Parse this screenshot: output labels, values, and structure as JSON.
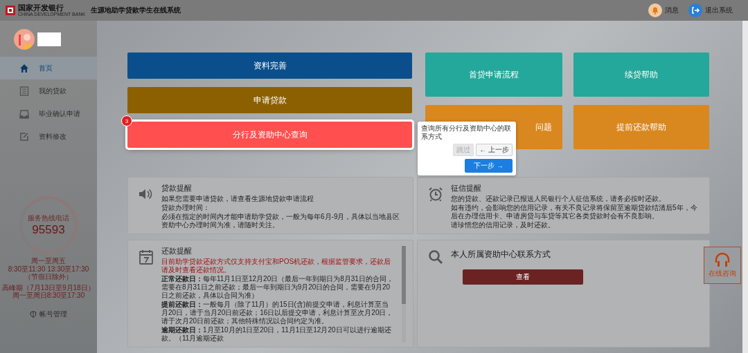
{
  "header": {
    "bank_name": "国家开发银行",
    "bank_name_en": "CHINA DEVELOPMENT BANK",
    "system_title": "生源地助学贷款学生在线系统",
    "actions": [
      {
        "label": "消息",
        "kind": "bell"
      },
      {
        "label": "退出系统",
        "kind": "logout"
      }
    ]
  },
  "sidebar": {
    "items": [
      {
        "label": "首页",
        "kind": "home",
        "selected": true
      },
      {
        "label": "我的贷款",
        "kind": "list",
        "selected": false
      },
      {
        "label": "毕业确认申请",
        "kind": "inbox",
        "selected": false
      },
      {
        "label": "资料修改",
        "kind": "edit",
        "selected": false
      }
    ],
    "hotline": {
      "title": "服务热线电话",
      "number": "95593",
      "hours": [
        "周一至周五",
        "8:30至11:30 13:30至17:30",
        "（节假日除外）"
      ],
      "peak_hours": [
        "高峰期（7月13日至9月18日）",
        "周一至周日8:30至17:30"
      ]
    },
    "account": "帐号管理"
  },
  "action_buttons": [
    {
      "label": "资料完善",
      "color": "#0a4f8c",
      "highlighted": false
    },
    {
      "label": "申请贷款",
      "color": "#8c6000",
      "highlighted": false
    },
    {
      "label": "分行及资助中心查询",
      "color": "#ff4f4f",
      "highlighted": true
    }
  ],
  "help_tiles": [
    {
      "label": "首贷申请流程",
      "color": "#24a89b"
    },
    {
      "label": "续贷帮助",
      "color": "#24a89b"
    },
    {
      "label": "问题",
      "color": "#d9871f"
    },
    {
      "label": "提前还款帮助",
      "color": "#d9871f"
    }
  ],
  "tour": {
    "step": "3",
    "text": "查询所有分行及资助中心的联系方式",
    "buttons": [
      {
        "label": "跳过",
        "disabled": true,
        "primary": false
      },
      {
        "label": "← 上一步",
        "disabled": false,
        "primary": false
      },
      {
        "label": "下一步 →",
        "disabled": false,
        "primary": true
      }
    ]
  },
  "panels": [
    {
      "kind": "speaker",
      "title": "贷款提醒",
      "lines": [
        {
          "text": "如果您需要申请贷款，请查看生源地贷款申请流程",
          "kind": "plain"
        },
        {
          "text": "贷款办理时间：",
          "kind": "plain"
        },
        {
          "text": "必须在指定的时间内才能申请助学贷款，一般为每年6月-9月，具体以当地县区资助中心办理时间为准，请随时关注。",
          "kind": "plain"
        }
      ]
    },
    {
      "kind": "clock",
      "title": "征信提醒",
      "lines": [
        {
          "text": "您的贷款、还款记录已报送人民银行个人征信系统，请务必按时还款。",
          "kind": "plain"
        },
        {
          "text": "如有违约，会影响您的信用记录，有关不良记录将保留至逾期贷款结清后5年，今后在办理信用卡、申请房贷与车贷等其它各类贷款时会有不良影响。",
          "kind": "plain"
        },
        {
          "text": "请珍惜您的信用记录，及时还款。",
          "kind": "plain"
        }
      ]
    },
    {
      "kind": "calendar",
      "title": "还款提醒",
      "lines": [
        {
          "text": "目前助学贷款还款方式仅支持支付宝和POS机还款，根据监管要求，还款后请及时查看还款情况。",
          "kind": "warning"
        },
        {
          "text": "**正常还款日：**每年11月1日至12月20日（最后一年到期日为8月31日的合同，需要在8月31日之前还款；最后一年到期日为9月20日的合同，需要在9月20日之前还款，具体以合同为准）",
          "kind": "plain"
        },
        {
          "text": "**提前还款日：**一般每月（除了11月）的15日(含)前提交申请，利息计算至当月20日，请于当月20日前还款；16日以后提交申请，利息计算至次月20日，请于次月20日前还款；其他特殊情况以合同约定为准。",
          "kind": "plain"
        },
        {
          "text": "**逾期还款日：**1月至10月的1日至20日，11月1日至12月20日可以进行逾期还款。（11月逾期还款",
          "kind": "plain"
        }
      ]
    },
    {
      "kind": "search",
      "title": "本人所属资助中心联系方式",
      "button": "查看"
    }
  ],
  "online_help": "在线咨询"
}
